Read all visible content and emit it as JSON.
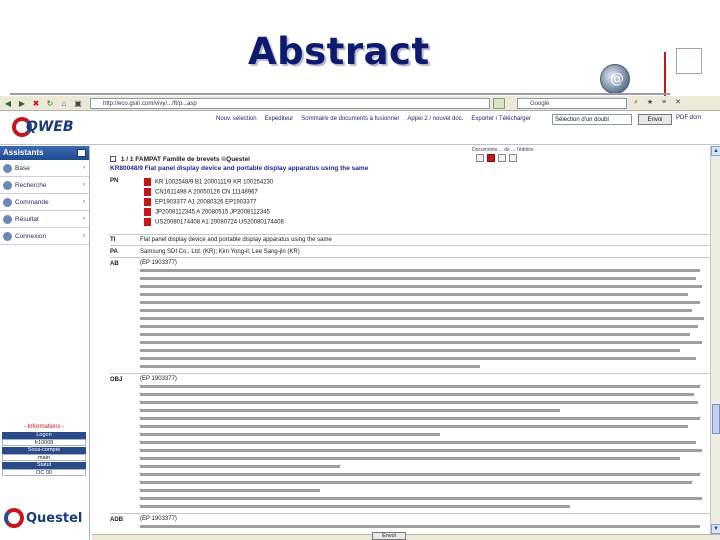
{
  "slide": {
    "title": "Abstract"
  },
  "browser": {
    "address": "http://eco.gsiri.com/vivy/.../ft/p...asp",
    "search_placeholder": "Google"
  },
  "app": {
    "logo": "QWEB",
    "top_menu": [
      "Nouv. sélection",
      "Expéditeur",
      "Sommaire de documents à fusionner",
      "Appel 2 / nouvel doc.",
      "Exporter / Télécharger"
    ],
    "language_select": "Sélection d'un doubl",
    "send_button": "Envoi",
    "top_right": "PDF dcm"
  },
  "sidebar": {
    "title": "Assistants",
    "items": [
      {
        "label": "Base"
      },
      {
        "label": "Recherche"
      },
      {
        "label": "Commande"
      },
      {
        "label": "Résultat"
      },
      {
        "label": "Connexion"
      }
    ],
    "info_title": "- Informations -",
    "info_rows": [
      {
        "label": "Logon",
        "value": "fr10008"
      },
      {
        "label": "Sous-compte",
        "value": "main"
      },
      {
        "label": "Statut",
        "value": "OC 00"
      }
    ],
    "logo": "Questel"
  },
  "document": {
    "toolbar_hint": "Documents ... de ... l'édition",
    "header": "1 / 1  FAMPAT  Famille de brevets  ©Questel",
    "title_line": "KR80048/9 Flat panel display device and portable display apparatus using the same",
    "fields": {
      "pn": "PN",
      "ti": "TI",
      "pa": "PA",
      "ab": "AB",
      "obj": "OBJ",
      "adb": "ADB"
    },
    "pn_rows": [
      "KR 1002548/9   B1   2000111/9 KR 100254230",
      "CN1611498   A   20050126   CN 11148967",
      "EP1903377   A1   20080326   EP1903377",
      "JP2008112345   A   20080515   JP2008112345",
      "US20080174408   A1   20080724   US20080174408"
    ],
    "ti_text": "Flat panel display device and portable display apparatus using the same",
    "pa_text": "Samsung SDI Co., Ltd. (KR); Kim Yong-il; Lee Sang-jin (KR)",
    "ab_prefix": "(EP 1903377)",
    "obj_prefix": "(EP 1903377)",
    "adb_prefix": "(EP 1903377)"
  },
  "bottom": {
    "send_button": "Envoi"
  }
}
